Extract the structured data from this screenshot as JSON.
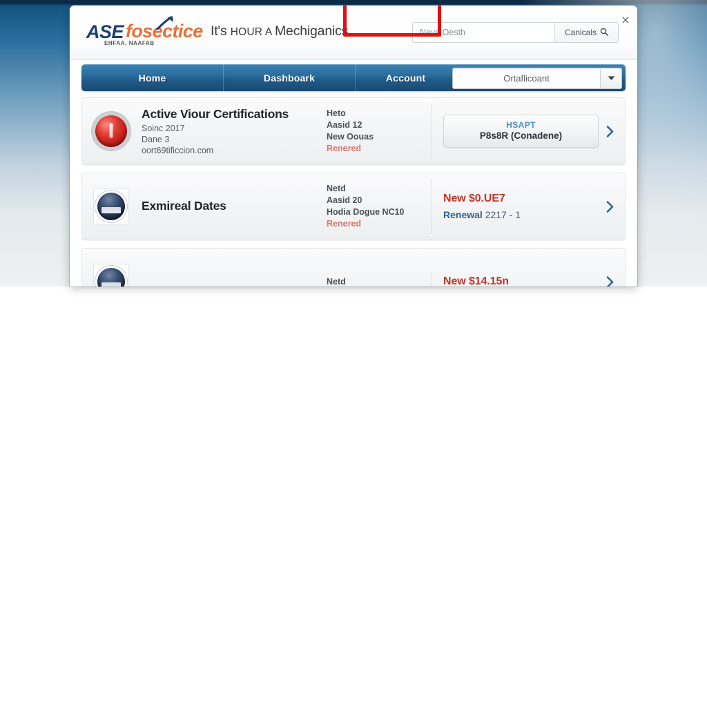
{
  "window": {
    "close_label": "×"
  },
  "header": {
    "brand": {
      "primary": "ASE",
      "secondary": "fosectice",
      "subtext": "EHFAA, NAAFAB",
      "arrow_icon": "up-arrow-icon"
    },
    "tagline_prefix": "It's ",
    "tagline_caps": "HOUR A ",
    "tagline_suffix": "Mechiganics",
    "search": {
      "placeholder": "Neve Oesth",
      "value": "",
      "button_label": "Canlcals",
      "button_icon": "search-icon"
    }
  },
  "nav": {
    "items": [
      {
        "label": "Home",
        "active": false
      },
      {
        "label": "Dashboark",
        "active": false
      },
      {
        "label": "Account",
        "active": true
      }
    ],
    "select": {
      "value": "Ortaflicoant",
      "caret_icon": "chevron-down-icon"
    },
    "highlight_color": "#e10f11",
    "bar_color": "#2a6c9c"
  },
  "cards": [
    {
      "icon": "red-seal-icon",
      "title": "Active Viour Certifications",
      "lines": [
        "Soinc 2017",
        "Dane 3",
        "oort69tificcion.com"
      ],
      "meta": [
        "Heto",
        "Aasid 12",
        "New Oouas"
      ],
      "status": "Renered",
      "action": {
        "type": "button",
        "top_label": "HSAPT",
        "sub_label": "P8s8R (Conadene)",
        "chevron_icon": "chevron-right-icon"
      }
    },
    {
      "icon": "navy-seal-icon",
      "title": "Exmireal Dates",
      "lines": [],
      "meta": [
        "Netd",
        "Aasid 20",
        "Hodia Dogue NC10"
      ],
      "status": "Renered",
      "action": {
        "type": "price",
        "new_price": "New $0.UE7",
        "renewal_label": "Renewal ",
        "renewal_value": "2217 - 1",
        "chevron_icon": "chevron-right-icon"
      }
    },
    {
      "icon": "seal-icon",
      "title": "",
      "lines": [],
      "meta": [
        "Netd"
      ],
      "status": "",
      "action": {
        "type": "price",
        "new_price": "New $14.15n",
        "renewal_label": "",
        "renewal_value": "",
        "chevron_icon": "chevron-right-icon"
      }
    }
  ],
  "colors": {
    "brand_navy": "#1d3f73",
    "brand_orange": "#e8703a",
    "nav_blue": "#2a6c9c",
    "highlight_red": "#e10f11",
    "price_red": "#c0342c",
    "link_blue": "#2e5f92"
  }
}
